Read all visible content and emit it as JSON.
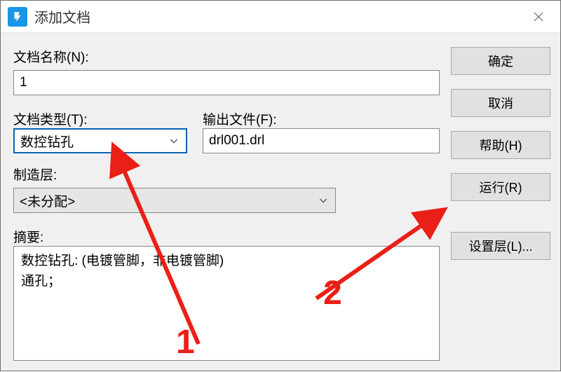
{
  "window": {
    "title": "添加文档"
  },
  "buttons": {
    "ok": "确定",
    "cancel": "取消",
    "help": "帮助(H)",
    "run": "运行(R)",
    "set_layer": "设置层(L)..."
  },
  "labels": {
    "doc_name": "文档名称(N):",
    "doc_type": "文档类型(T):",
    "output_file": "输出文件(F):",
    "mfg_layer": "制造层:",
    "summary": "摘要:"
  },
  "values": {
    "doc_name": "1",
    "doc_type": "数控钻孔",
    "output_file": "drl001.drl",
    "mfg_layer": "<未分配>",
    "summary": "数控钻孔: (电镀管脚，非电镀管脚)\n通孔；"
  },
  "annotations": {
    "one": "1",
    "two": "2"
  }
}
